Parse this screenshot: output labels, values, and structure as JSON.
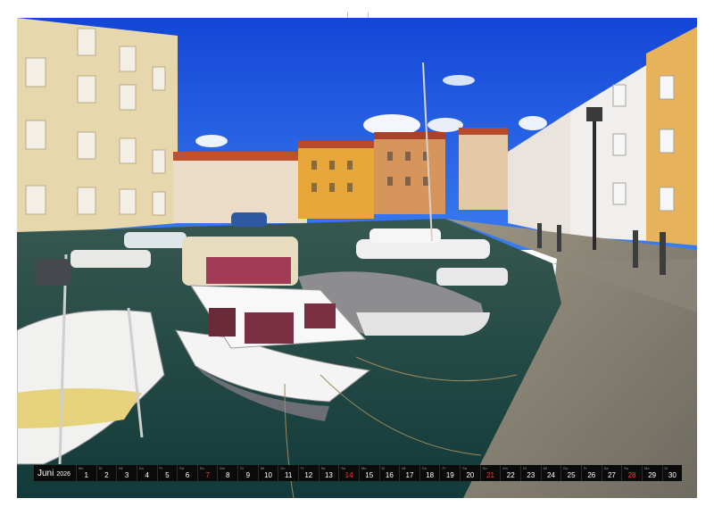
{
  "calendar": {
    "month": "Juni",
    "year": "2026",
    "days": [
      {
        "wd": "Mo",
        "n": "1"
      },
      {
        "wd": "Di",
        "n": "2"
      },
      {
        "wd": "Mi",
        "n": "3"
      },
      {
        "wd": "Do",
        "n": "4"
      },
      {
        "wd": "Fr",
        "n": "5"
      },
      {
        "wd": "Sa",
        "n": "6"
      },
      {
        "wd": "So",
        "n": "7",
        "sun": true
      },
      {
        "wd": "Mo",
        "n": "8"
      },
      {
        "wd": "Di",
        "n": "9"
      },
      {
        "wd": "Mi",
        "n": "10"
      },
      {
        "wd": "Do",
        "n": "11"
      },
      {
        "wd": "Fr",
        "n": "12"
      },
      {
        "wd": "Sa",
        "n": "13"
      },
      {
        "wd": "So",
        "n": "14",
        "sun": true
      },
      {
        "wd": "Mo",
        "n": "15"
      },
      {
        "wd": "Di",
        "n": "16"
      },
      {
        "wd": "Mi",
        "n": "17"
      },
      {
        "wd": "Do",
        "n": "18"
      },
      {
        "wd": "Fr",
        "n": "19"
      },
      {
        "wd": "Sa",
        "n": "20"
      },
      {
        "wd": "So",
        "n": "21",
        "sun": true
      },
      {
        "wd": "Mo",
        "n": "22"
      },
      {
        "wd": "Di",
        "n": "23"
      },
      {
        "wd": "Mi",
        "n": "24"
      },
      {
        "wd": "Do",
        "n": "25"
      },
      {
        "wd": "Fr",
        "n": "26"
      },
      {
        "wd": "Sa",
        "n": "27"
      },
      {
        "wd": "So",
        "n": "28",
        "sun": true
      },
      {
        "wd": "Mo",
        "n": "29"
      },
      {
        "wd": "Di",
        "n": "30"
      }
    ]
  },
  "colors": {
    "sky": "#1f5fe0",
    "water": "#1d4a46",
    "sunday": "#ff3b30",
    "bar": "#0b0b0c"
  }
}
